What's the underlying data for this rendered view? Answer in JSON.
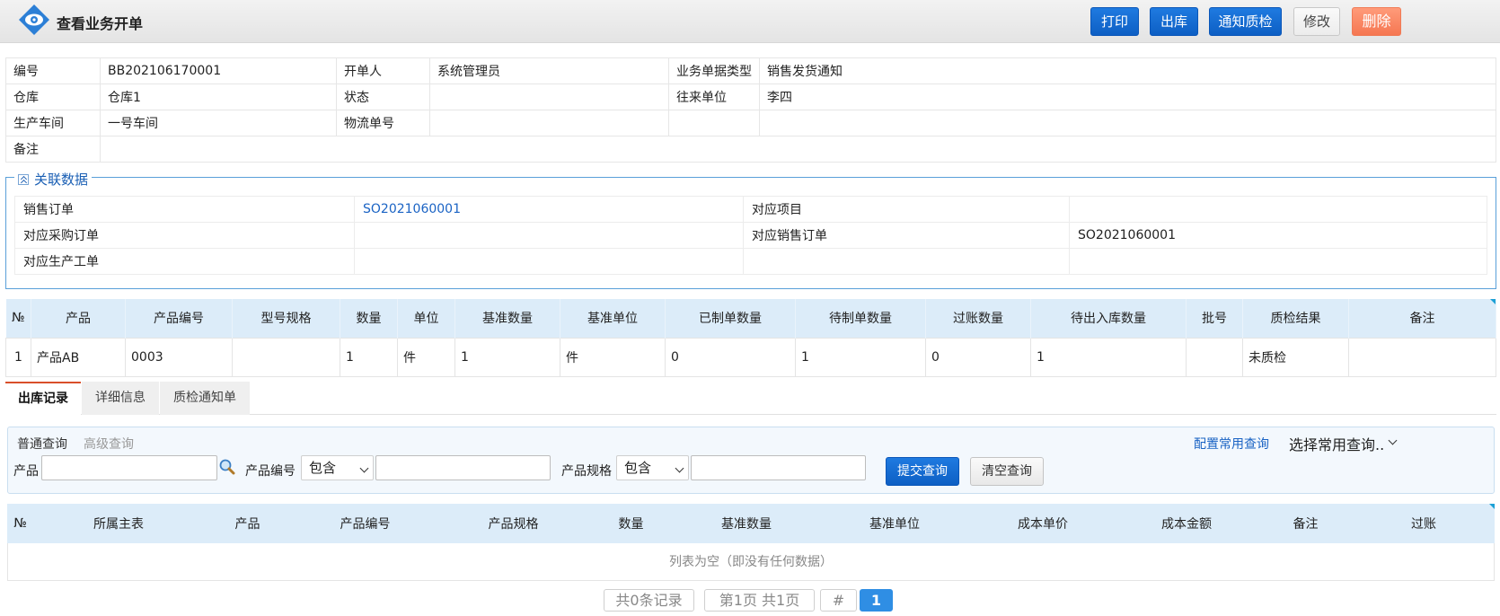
{
  "header": {
    "title": "查看业务开单",
    "buttons": {
      "print": "打印",
      "outbound": "出库",
      "notify_qc": "通知质检",
      "edit": "修改",
      "delete": "删除"
    }
  },
  "info": {
    "rows": [
      [
        "编号",
        "BB202106170001",
        "开单人",
        "系统管理员",
        "业务单据类型",
        "销售发货通知"
      ],
      [
        "仓库",
        "仓库1",
        "状态",
        "",
        "往来单位",
        "李四"
      ],
      [
        "生产车间",
        "一号车间",
        "物流单号",
        "",
        "",
        ""
      ]
    ],
    "remark_label": "备注",
    "remark_value": ""
  },
  "related": {
    "legend": "关联数据",
    "rows": [
      [
        "销售订单",
        "SO2021060001",
        "对应项目",
        ""
      ],
      [
        "对应采购订单",
        "",
        "对应销售订单",
        "SO2021060001"
      ],
      [
        "对应生产工单",
        "",
        "",
        ""
      ]
    ]
  },
  "products": {
    "headers": [
      "№",
      "产品",
      "产品编号",
      "型号规格",
      "数量",
      "单位",
      "基准数量",
      "基准单位",
      "已制单数量",
      "待制单数量",
      "过账数量",
      "待出入库数量",
      "批号",
      "质检结果",
      "备注"
    ],
    "rows": [
      [
        "1",
        "产品AB",
        "0003",
        "",
        "1",
        "件",
        "1",
        "件",
        "0",
        "1",
        "0",
        "1",
        "",
        "未质检",
        ""
      ]
    ]
  },
  "tabs": [
    "出库记录",
    "详细信息",
    "质检通知单"
  ],
  "query": {
    "normal": "普通查询",
    "advanced": "高级查询",
    "config": "配置常用查询",
    "choose": "选择常用查询..",
    "product_label": "产品",
    "product_code_label": "产品编号",
    "product_spec_label": "产品规格",
    "contains": "包含",
    "submit": "提交查询",
    "clear": "清空查询"
  },
  "outbound": {
    "headers": [
      "№",
      "所属主表",
      "产品",
      "产品编号",
      "产品规格",
      "数量",
      "基准数量",
      "基准单位",
      "成本单价",
      "成本金额",
      "备注",
      "过账"
    ],
    "empty_text": "列表为空（即没有任何数据）"
  },
  "pagination": {
    "total": "共0条记录",
    "pages": "第1页 共1页",
    "hash": "#",
    "current": "1"
  },
  "colors": {
    "primary": "#0d5fc4",
    "danger": "#f57752",
    "header_bg": "#dcecf9",
    "link": "#1a63c4"
  }
}
